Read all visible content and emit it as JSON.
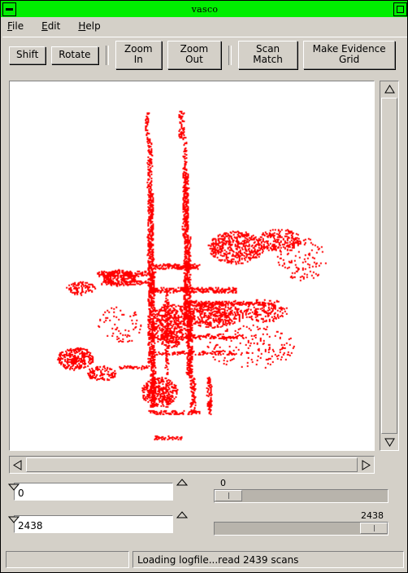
{
  "window": {
    "title": "vasco",
    "minimize_icon": "minimize-icon",
    "maximize_icon": "maximize-icon",
    "titlebar_color": "#00ee00",
    "face_color": "#d4d0c8"
  },
  "menubar": {
    "items": [
      {
        "label": "File",
        "mnemonic": "F",
        "rest": "ile"
      },
      {
        "label": "Edit",
        "mnemonic": "E",
        "rest": "dit"
      },
      {
        "label": "Help",
        "mnemonic": "H",
        "rest": "elp"
      }
    ]
  },
  "toolbar": {
    "buttons": [
      {
        "label": "Shift"
      },
      {
        "label": "Rotate"
      },
      {
        "label": "Zoom In"
      },
      {
        "label": "Zoom Out"
      },
      {
        "label": "Scan Match"
      },
      {
        "label": "Make Evidence Grid"
      }
    ]
  },
  "canvas": {
    "background": "#ffffff",
    "point_color": "#ff0000",
    "description": "laser-scan-point-cloud-map"
  },
  "scrollbars": {
    "vertical": {
      "up_icon": "scroll-up-arrow-icon",
      "down_icon": "scroll-down-arrow-icon"
    },
    "horizontal": {
      "left_icon": "scroll-left-arrow-icon",
      "right_icon": "scroll-right-arrow-icon"
    }
  },
  "controls": {
    "start_spinner": {
      "value": "0",
      "placeholder": "0"
    },
    "end_spinner": {
      "value": "2438",
      "placeholder": "2438"
    },
    "start_slider": {
      "label": "0",
      "value": 0,
      "min": 0,
      "max": 2438,
      "position_pct": 0
    },
    "end_slider": {
      "label": "2438",
      "value": 2438,
      "min": 0,
      "max": 2438,
      "position_pct": 100
    }
  },
  "statusbar": {
    "left_pane": "",
    "message": "Loading logfile...read 2439 scans"
  },
  "scan_map": {
    "seed": 20240117,
    "strokes": [
      {
        "type": "vline",
        "x": 0.375,
        "y0": 0.085,
        "y1": 0.155,
        "w": 2.0,
        "d": 0.45
      },
      {
        "type": "vline",
        "x": 0.383,
        "y0": 0.155,
        "y1": 0.3,
        "w": 2.2,
        "d": 0.6
      },
      {
        "type": "vline",
        "x": 0.385,
        "y0": 0.3,
        "y1": 0.52,
        "w": 3.0,
        "d": 0.92
      },
      {
        "type": "vline",
        "x": 0.388,
        "y0": 0.52,
        "y1": 0.76,
        "w": 3.2,
        "d": 0.95
      },
      {
        "type": "vline",
        "x": 0.392,
        "y0": 0.76,
        "y1": 0.88,
        "w": 2.6,
        "d": 0.8
      },
      {
        "type": "vline",
        "x": 0.47,
        "y0": 0.08,
        "y1": 0.15,
        "w": 2.6,
        "d": 0.55
      },
      {
        "type": "vline",
        "x": 0.478,
        "y0": 0.15,
        "y1": 0.25,
        "w": 2.0,
        "d": 0.45
      },
      {
        "type": "vline",
        "x": 0.482,
        "y0": 0.25,
        "y1": 0.42,
        "w": 3.0,
        "d": 0.9
      },
      {
        "type": "vline",
        "x": 0.486,
        "y0": 0.42,
        "y1": 0.64,
        "w": 3.4,
        "d": 0.95
      },
      {
        "type": "vline",
        "x": 0.492,
        "y0": 0.64,
        "y1": 0.8,
        "w": 3.0,
        "d": 0.88
      },
      {
        "type": "vline",
        "x": 0.5,
        "y0": 0.8,
        "y1": 0.9,
        "w": 2.4,
        "d": 0.75
      },
      {
        "type": "vline",
        "x": 0.43,
        "y0": 0.56,
        "y1": 0.88,
        "w": 1.6,
        "d": 0.45
      },
      {
        "type": "vline",
        "x": 0.545,
        "y0": 0.8,
        "y1": 0.9,
        "w": 2.2,
        "d": 0.7
      },
      {
        "type": "hline",
        "y": 0.52,
        "x0": 0.24,
        "x1": 0.4,
        "w": 2.4,
        "d": 0.7
      },
      {
        "type": "hline",
        "y": 0.545,
        "x0": 0.25,
        "x1": 0.39,
        "w": 1.8,
        "d": 0.45
      },
      {
        "type": "hline",
        "y": 0.5,
        "x0": 0.385,
        "x1": 0.52,
        "w": 2.6,
        "d": 0.78
      },
      {
        "type": "hline",
        "y": 0.565,
        "x0": 0.385,
        "x1": 0.62,
        "w": 2.6,
        "d": 0.72
      },
      {
        "type": "hline",
        "y": 0.6,
        "x0": 0.48,
        "x1": 0.7,
        "w": 2.2,
        "d": 0.55
      },
      {
        "type": "hline",
        "y": 0.69,
        "x0": 0.48,
        "x1": 0.64,
        "w": 2.2,
        "d": 0.55
      },
      {
        "type": "hline",
        "y": 0.735,
        "x0": 0.39,
        "x1": 0.62,
        "w": 2.0,
        "d": 0.5
      },
      {
        "type": "hline",
        "y": 0.775,
        "x0": 0.3,
        "x1": 0.4,
        "w": 2.0,
        "d": 0.5
      },
      {
        "type": "hline",
        "y": 0.895,
        "x0": 0.38,
        "x1": 0.52,
        "w": 2.0,
        "d": 0.6
      },
      {
        "type": "hline",
        "y": 0.965,
        "x0": 0.395,
        "x1": 0.47,
        "w": 1.8,
        "d": 0.65
      },
      {
        "type": "blob",
        "cx": 0.3,
        "cy": 0.53,
        "rx": 0.045,
        "ry": 0.022,
        "d": 0.45
      },
      {
        "type": "blob",
        "cx": 0.195,
        "cy": 0.56,
        "rx": 0.04,
        "ry": 0.018,
        "d": 0.3
      },
      {
        "type": "blob",
        "cx": 0.18,
        "cy": 0.75,
        "rx": 0.05,
        "ry": 0.03,
        "d": 0.38
      },
      {
        "type": "blob",
        "cx": 0.25,
        "cy": 0.79,
        "rx": 0.04,
        "ry": 0.02,
        "d": 0.3
      },
      {
        "type": "blob",
        "cx": 0.62,
        "cy": 0.45,
        "rx": 0.075,
        "ry": 0.045,
        "d": 0.3
      },
      {
        "type": "blob",
        "cx": 0.74,
        "cy": 0.43,
        "rx": 0.06,
        "ry": 0.03,
        "d": 0.22
      },
      {
        "type": "blob",
        "cx": 0.56,
        "cy": 0.63,
        "rx": 0.08,
        "ry": 0.035,
        "d": 0.35
      },
      {
        "type": "blob",
        "cx": 0.7,
        "cy": 0.62,
        "rx": 0.06,
        "ry": 0.03,
        "d": 0.2
      },
      {
        "type": "blob",
        "cx": 0.44,
        "cy": 0.66,
        "rx": 0.055,
        "ry": 0.06,
        "d": 0.35
      },
      {
        "type": "blob",
        "cx": 0.41,
        "cy": 0.84,
        "rx": 0.05,
        "ry": 0.04,
        "d": 0.35
      },
      {
        "type": "noise",
        "cx": 0.8,
        "cy": 0.48,
        "rx": 0.07,
        "ry": 0.06,
        "d": 0.06
      },
      {
        "type": "noise",
        "cx": 0.66,
        "cy": 0.72,
        "rx": 0.12,
        "ry": 0.06,
        "d": 0.05
      },
      {
        "type": "noise",
        "cx": 0.3,
        "cy": 0.66,
        "rx": 0.06,
        "ry": 0.05,
        "d": 0.05
      }
    ]
  }
}
